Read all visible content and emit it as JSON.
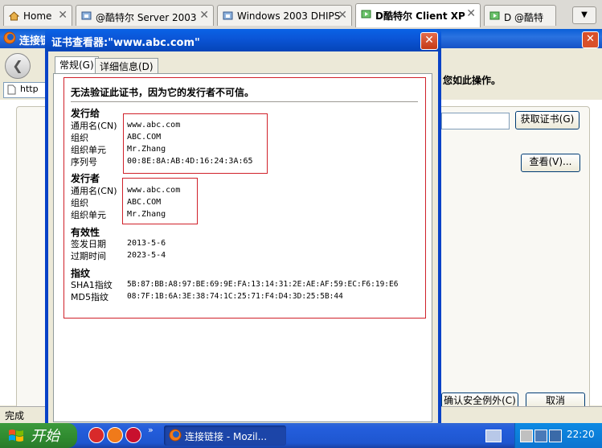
{
  "vm_tabs": [
    {
      "label": "Home"
    },
    {
      "label": "@酷特尔 Server 2003"
    },
    {
      "label": "Windows 2003 DHIPS"
    },
    {
      "label": "D酷特尔 Client XP"
    },
    {
      "label": "D @酷特"
    }
  ],
  "firefox": {
    "title_partial": "连接链",
    "address_partial": "http",
    "notice_partial": "您如此操作。",
    "get_cert_label": "获取证书(G)",
    "view_label": "查看(V)...",
    "confirm_exception_label": "确认安全例外(C)",
    "cancel_label": "取消",
    "status_text": "完成"
  },
  "cert_dialog": {
    "title": "证书查看器:\"www.abc.com\"",
    "tabs": [
      {
        "label": "常规(G)"
      },
      {
        "label": "详细信息(D)"
      }
    ],
    "warning": "无法验证此证书，因为它的发行者不可信。",
    "issued_to": {
      "heading": "发行给",
      "rows": [
        {
          "label": "通用名(CN)",
          "value": "www.abc.com"
        },
        {
          "label": "组织",
          "value": "ABC.COM"
        },
        {
          "label": "组织单元",
          "value": "Mr.Zhang"
        },
        {
          "label": "序列号",
          "value": "00:8E:8A:AB:4D:16:24:3A:65"
        }
      ]
    },
    "issued_by": {
      "heading": "发行者",
      "rows": [
        {
          "label": "通用名(CN)",
          "value": "www.abc.com"
        },
        {
          "label": "组织",
          "value": "ABC.COM"
        },
        {
          "label": "组织单元",
          "value": "Mr.Zhang"
        }
      ]
    },
    "validity": {
      "heading": "有效性",
      "rows": [
        {
          "label": "签发日期",
          "value": "2013-5-6"
        },
        {
          "label": "过期时间",
          "value": "2023-5-4"
        }
      ]
    },
    "fingerprints": {
      "heading": "指纹",
      "rows": [
        {
          "label": "SHA1指纹",
          "value": "5B:87:BB:A8:97:BE:69:9E:FA:13:14:31:2E:AE:AF:59:EC:F6:19:E6"
        },
        {
          "label": "MD5指纹",
          "value": "08:7F:1B:6A:3E:38:74:1C:25:71:F4:D4:3D:25:5B:44"
        }
      ]
    }
  },
  "taskbar": {
    "start_label": "开始",
    "task_label": "连接链接 - Mozil...",
    "clock": "22:20"
  }
}
